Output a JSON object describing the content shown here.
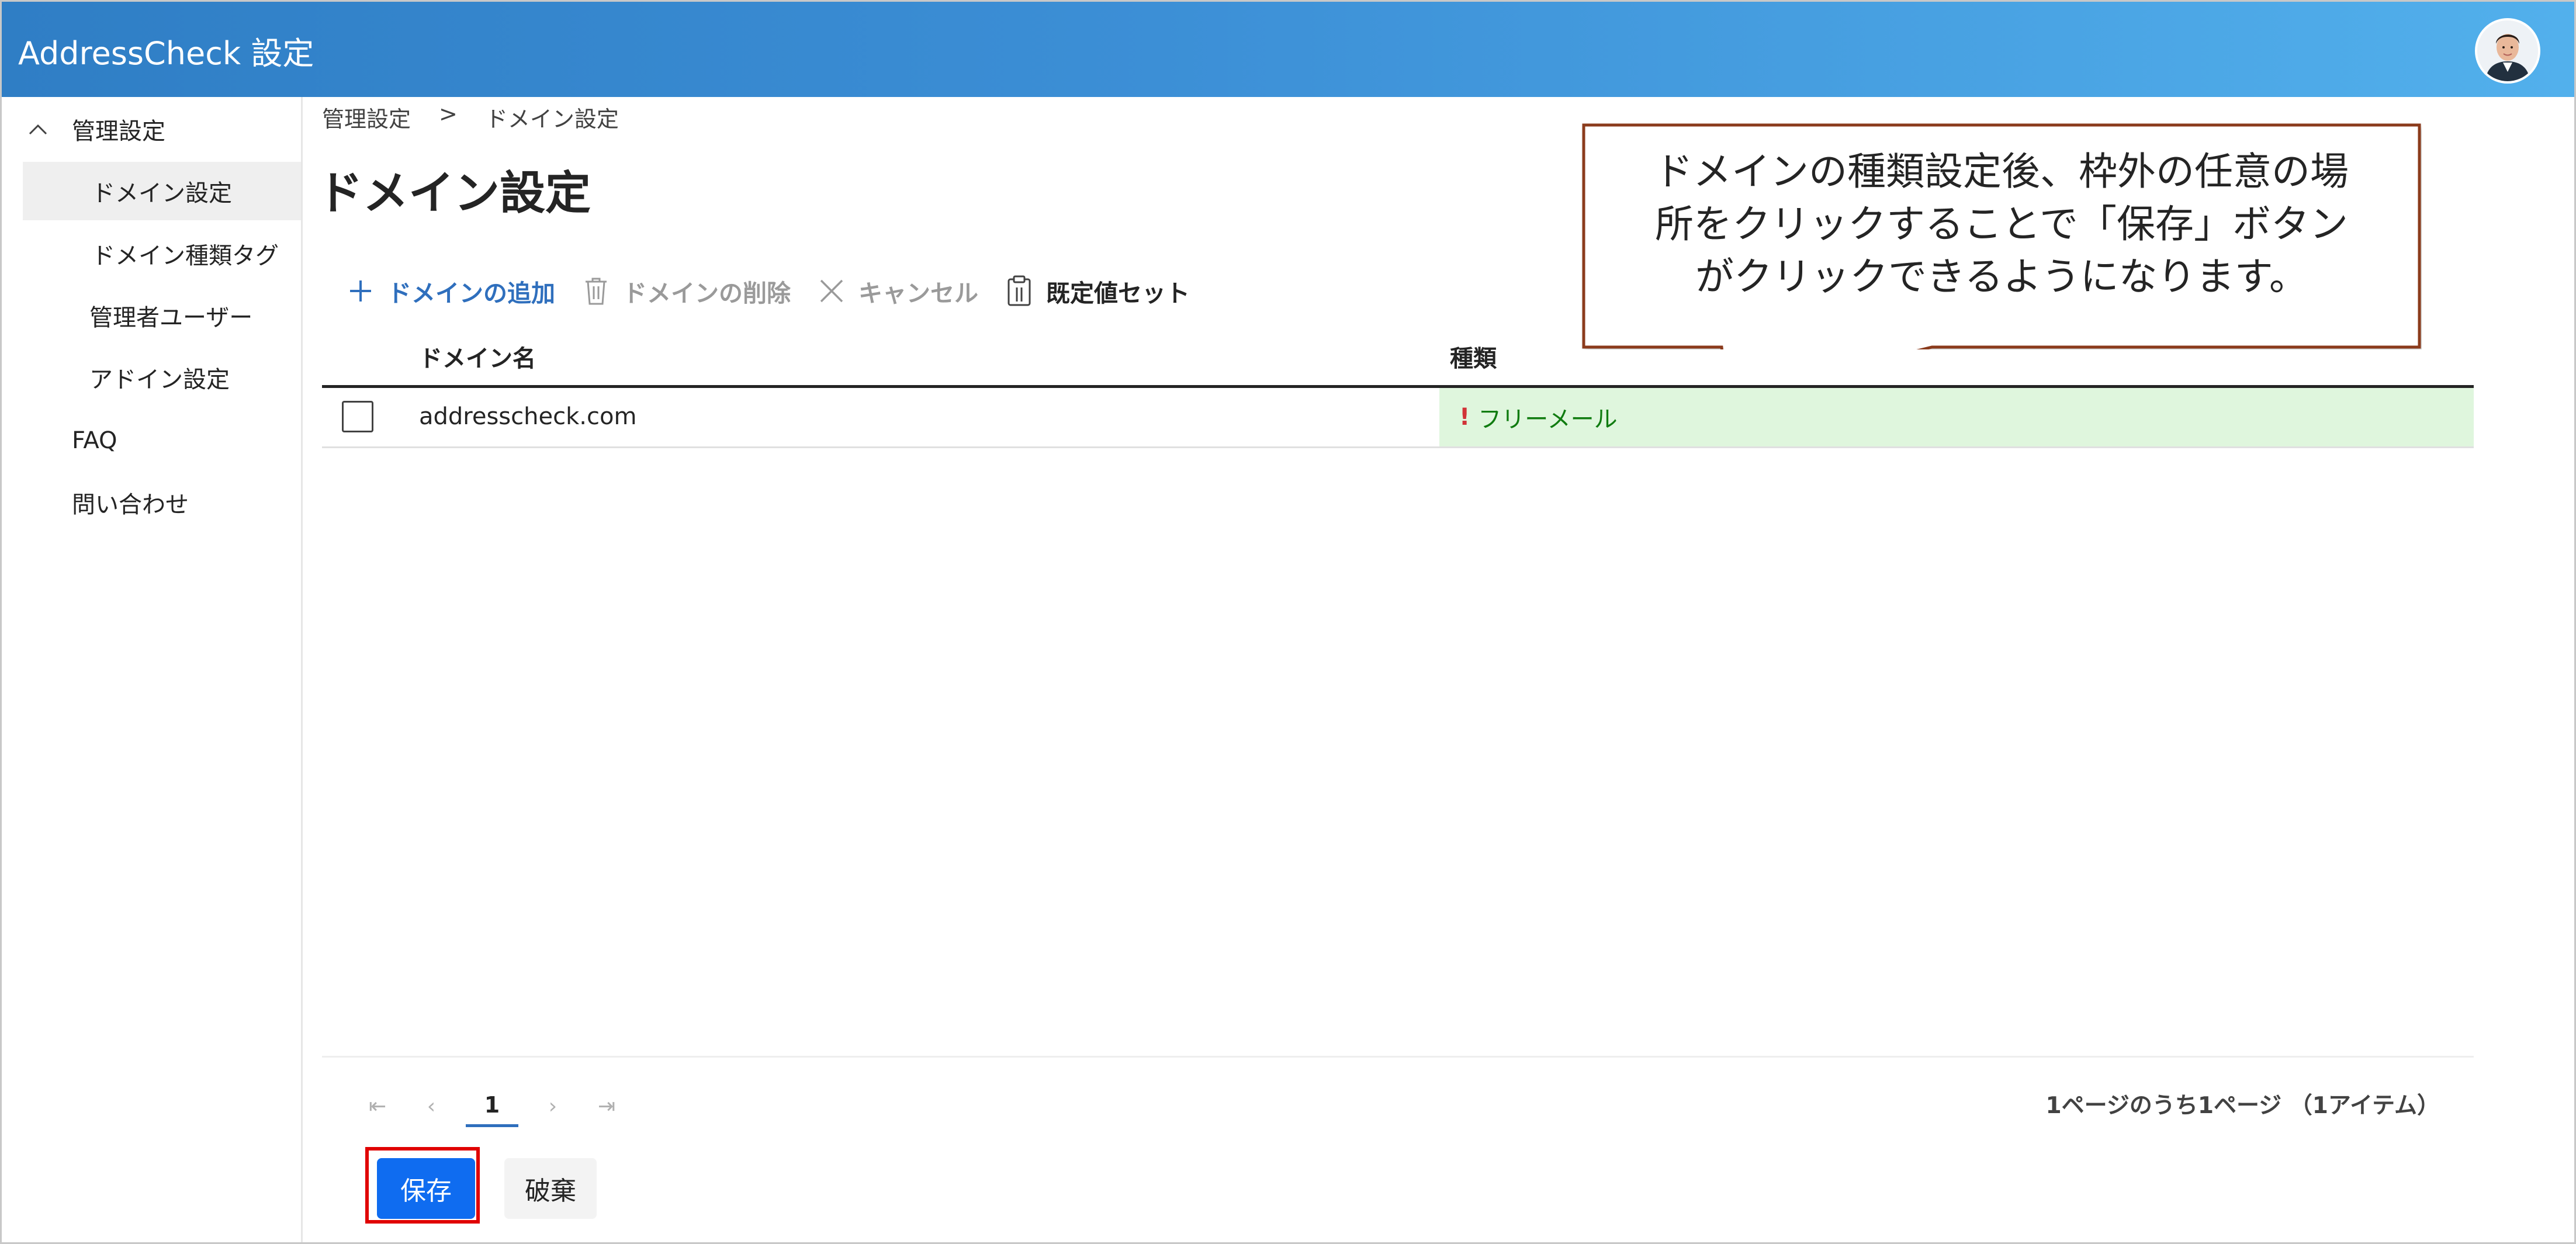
{
  "header": {
    "app_title": "AddressCheck 設定",
    "avatar_icon": "user-avatar"
  },
  "sidebar": {
    "items": [
      {
        "label": "管理設定",
        "icon": "chevron-up-icon"
      },
      {
        "label": "ドメイン設定",
        "selected": true
      },
      {
        "label": "ドメイン種類タグ"
      },
      {
        "label": "管理者ユーザー"
      },
      {
        "label": "アドイン設定"
      },
      {
        "label": "FAQ"
      },
      {
        "label": "問い合わせ"
      }
    ]
  },
  "breadcrumb": {
    "parent": "管理設定",
    "separator": ">",
    "current": "ドメイン設定"
  },
  "page": {
    "title": "ドメイン設定"
  },
  "toolbar": {
    "add_label": "ドメインの追加",
    "delete_label": "ドメインの削除",
    "cancel_label": "キャンセル",
    "default_label": "既定値セット"
  },
  "table": {
    "columns": [
      "ドメイン名",
      "種類"
    ],
    "rows": [
      {
        "domain": "addresscheck.com",
        "type": "フリーメール",
        "type_marker": "!"
      }
    ]
  },
  "pagination": {
    "first": "⇤",
    "prev": "‹",
    "current_page": "1",
    "next": "›",
    "last": "⇥",
    "info": "1ページのうち1ページ （1アイテム）"
  },
  "actions": {
    "save_label": "保存",
    "discard_label": "破棄"
  },
  "callout": {
    "lines": [
      "ドメインの種類設定後、枠外の任意の場",
      "所をクリックすることで「保存」ボタン",
      "がクリックできるようになります。"
    ]
  },
  "colors": {
    "accent": "#0f6cf0",
    "header_start": "#2f7ec5",
    "header_end": "#52b0ec",
    "row_highlight": "#dff6dd",
    "type_text": "#107c10",
    "callout_border": "#8b3a1e",
    "highlight_box": "#e00000"
  }
}
